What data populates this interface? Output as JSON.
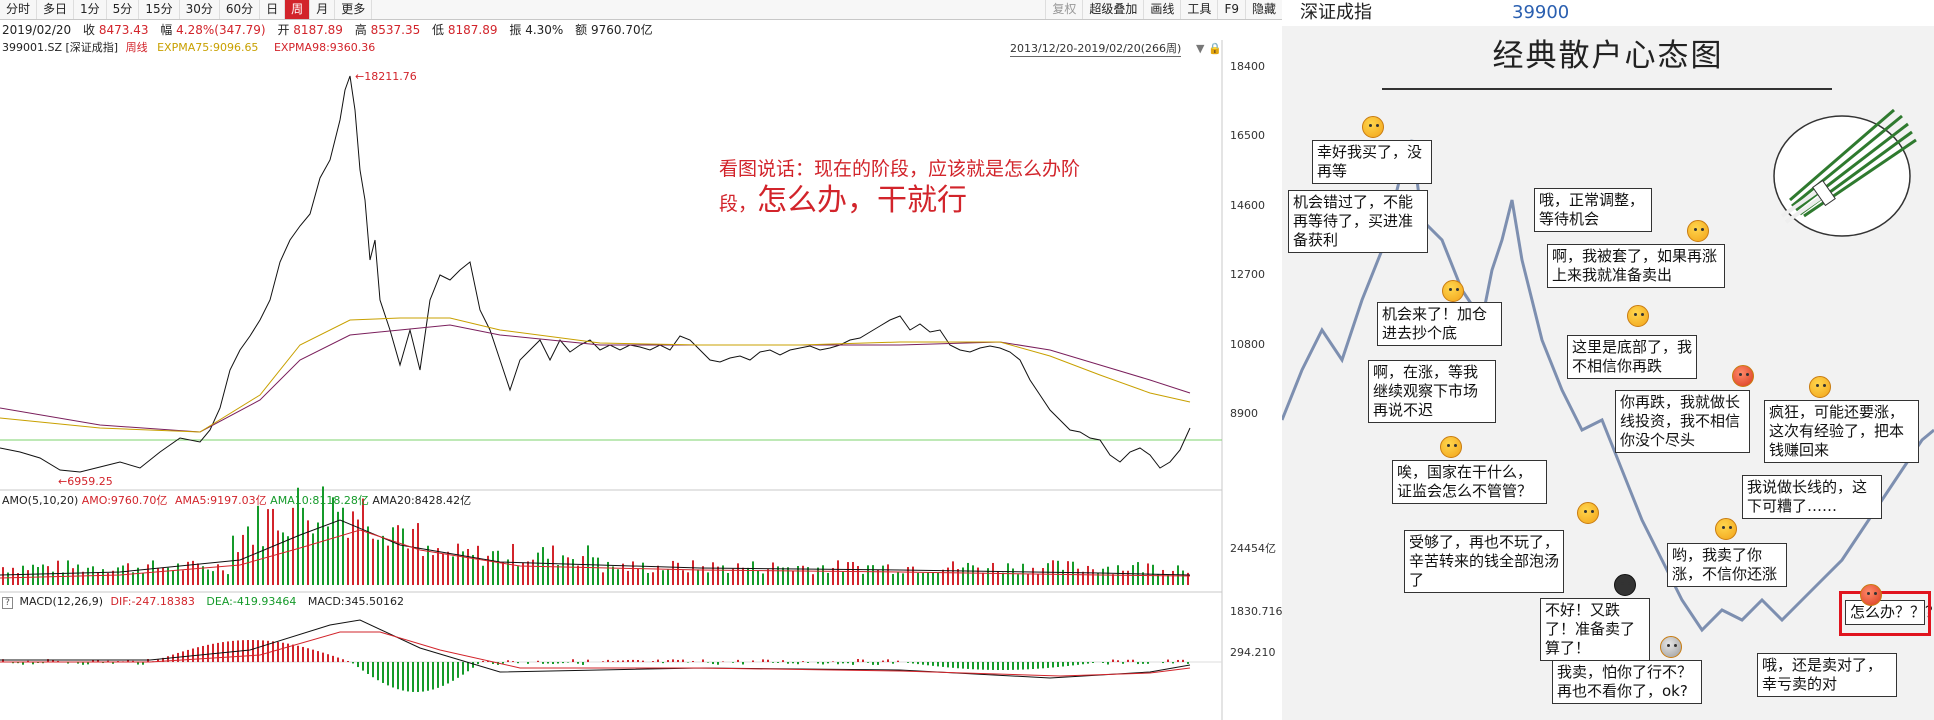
{
  "toolbar": {
    "periods": [
      "分时",
      "多日",
      "1分",
      "5分",
      "15分",
      "30分",
      "60分",
      "日",
      "周",
      "月",
      "更多"
    ],
    "active": "周",
    "right": [
      "复权",
      "超级叠加",
      "画线",
      "工具",
      "F9",
      "隐藏"
    ]
  },
  "info": {
    "date": "2019/02/20",
    "close_label": "收",
    "close": "8473.43",
    "change_label": "幅",
    "change": "4.28%(347.79)",
    "open_label": "开",
    "open": "8187.89",
    "high_label": "高",
    "high": "8537.35",
    "low_label": "低",
    "low": "8187.89",
    "amp_label": "振",
    "amp": "4.30%",
    "amount_label": "额",
    "amount": "9760.70亿"
  },
  "indicators": {
    "code": "399001.SZ",
    "name": "[深证成指]",
    "period": "周线",
    "ema75": "EXPMA75:9096.65",
    "ema98": "EXPMA98:9360.36",
    "range": "2013/12/20-2019/02/20(266周)"
  },
  "price_axis": [
    "18400",
    "16500",
    "14600",
    "12700",
    "10800",
    "8900"
  ],
  "price_marks": {
    "high": "18211.76",
    "low": "6959.25"
  },
  "annotation": {
    "line1": "看图说话：现在的阶段，应该就是怎么办阶",
    "line2_small": "段，",
    "line2_big": "怎么办，干就行"
  },
  "amo": {
    "name": "AMO(5,10,20)",
    "amo": "AMO:9760.70亿",
    "ama5": "AMA5:9197.03亿",
    "ama10": "AMA10:8118.28亿",
    "ama20": "AMA20:8428.42亿",
    "axis": "24454亿"
  },
  "macd": {
    "q": "?",
    "name": "MACD(12,26,9)",
    "dif": "DIF:-247.18383",
    "dea": "DEA:-419.93464",
    "macd": "MACD:345.50162",
    "axis_top": "1830.716",
    "axis_mid": "294.210"
  },
  "colors": {
    "up": "#d2242b",
    "down": "#159a2a",
    "ema75": "#c8a000",
    "ema98": "#7a1f5c",
    "price": "#111111",
    "hline": "#7ed36c"
  },
  "cartoon": {
    "header_name": "深证成指",
    "header_code": "39900",
    "title": "经典散户心态图",
    "bubbles": [
      "幸好我买了，没再等",
      "机会错过了，不能再等待了，买进准备获利",
      "哦，正常调整，等待机会",
      "啊，我被套了，如果再涨上来我就准备卖出",
      "机会来了！加仓进去抄个底",
      "这里是底部了，我不相信你再跌",
      "啊，在涨，等我继续观察下市场再说不迟",
      "你再跌，我就做长线投资，我不相信你没个尽头",
      "疯狂，可能还要涨，这次有经验了，把本钱赚回来",
      "唉，国家在干什么，证监会怎么不管管？",
      "我说做长线的，这下可糟了……",
      "受够了，再也不玩了，辛苦转来的钱全部泡汤了",
      "哟，我卖了你涨，不信你还涨",
      "不好！又跌了！准备卖了算了！",
      "怎么办？？？",
      "我卖，怕你了行不？再也不看你了，ok?",
      "哦，还是卖对了，幸亏卖的对"
    ]
  }
}
